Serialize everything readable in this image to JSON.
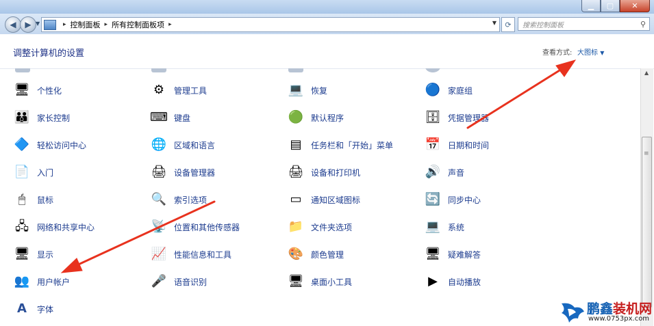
{
  "window": {
    "buttons": {
      "minimize_icon": "minimize-icon",
      "maximize_icon": "maximize-icon",
      "close_icon": "close-icon"
    }
  },
  "addressbar": {
    "breadcrumb": [
      "控制面板",
      "所有控制面板项"
    ],
    "search_placeholder": "搜索控制面板"
  },
  "header": {
    "title": "调整计算机的设置",
    "view_label": "查看方式:",
    "view_value": "大图标"
  },
  "items": [
    [
      "个性化",
      "管理工具",
      "恢复",
      "家庭组"
    ],
    [
      "家长控制",
      "键盘",
      "默认程序",
      "凭据管理器"
    ],
    [
      "轻松访问中心",
      "区域和语言",
      "任务栏和「开始」菜单",
      "日期和时间"
    ],
    [
      "入门",
      "设备管理器",
      "设备和打印机",
      "声音"
    ],
    [
      "鼠标",
      "索引选项",
      "通知区域图标",
      "同步中心"
    ],
    [
      "网络和共享中心",
      "位置和其他传感器",
      "文件夹选项",
      "系统"
    ],
    [
      "显示",
      "性能信息和工具",
      "颜色管理",
      "疑难解答"
    ],
    [
      "用户帐户",
      "语音识别",
      "桌面小工具",
      "自动播放"
    ],
    [
      "字体"
    ]
  ],
  "watermark": {
    "brand_part1": "鹏鑫",
    "brand_part2": "装机网",
    "url": "www.0753px.com"
  },
  "annotations": {
    "arrow_color": "#e8321e"
  }
}
